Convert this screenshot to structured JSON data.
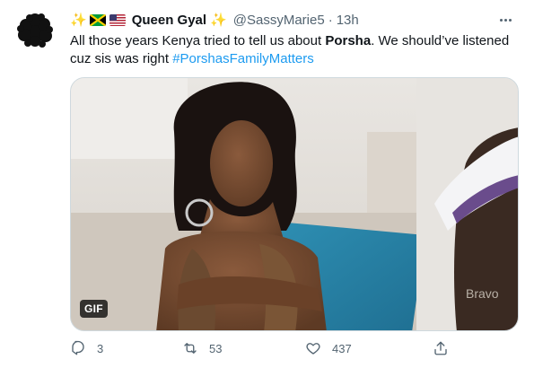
{
  "tweet": {
    "display_name": "Queen Gyal",
    "handle": "@SassyMarie5",
    "separator": "·",
    "time": "13h",
    "text_parts": {
      "p1": "All those years Kenya tried to tell us about ",
      "p2": "Porsha",
      "p3": ". We should’ve listened cuz sis was right  ",
      "hashtag": "#PorshasFamilyMatters"
    },
    "media": {
      "badge": "GIF"
    },
    "metrics": {
      "replies": "3",
      "retweets": "53",
      "likes": "437"
    },
    "icons": {
      "header": [
        "sparkle-icon",
        "jamaica-flag-icon",
        "us-flag-icon",
        "sparkle-icon"
      ],
      "more": "more-icon",
      "actions": [
        "reply-icon",
        "retweet-icon",
        "like-icon",
        "share-icon"
      ]
    },
    "colors": {
      "link": "#1d9bf0",
      "secondary_text": "#536471",
      "primary_text": "#0f1419"
    }
  }
}
